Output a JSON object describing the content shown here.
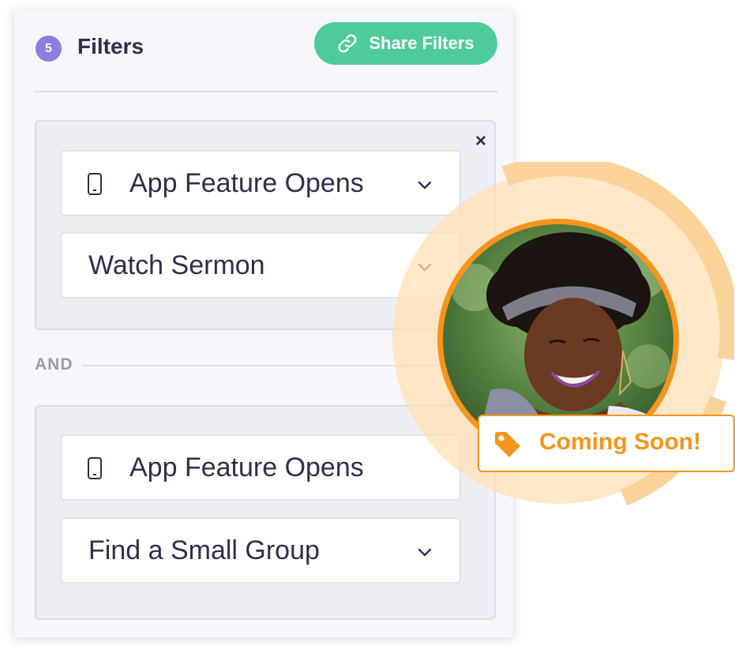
{
  "header": {
    "filter_count": "5",
    "title": "Filters",
    "share_label": "Share Filters",
    "share_icon": "link-icon"
  },
  "groups": [
    {
      "close_label": "×",
      "selects": [
        {
          "label": "App Feature Opens",
          "icon": "phone-icon",
          "has_chevron": true
        },
        {
          "label": "Watch Sermon",
          "icon": null,
          "has_chevron": true
        }
      ]
    },
    {
      "selects": [
        {
          "label": "App Feature Opens",
          "icon": "phone-icon",
          "has_chevron": false
        },
        {
          "label": "Find a Small Group",
          "icon": null,
          "has_chevron": true
        }
      ]
    }
  ],
  "connector": {
    "label": "AND"
  },
  "promo": {
    "badge_label": "Coming Soon!",
    "badge_icon": "tag-icon"
  },
  "colors": {
    "accent_purple": "#8b7fe0",
    "share_green": "#4ecb9b",
    "promo_orange": "#f7941d",
    "promo_ring": "#fbd39a",
    "text_dark": "#2f2e4a"
  }
}
